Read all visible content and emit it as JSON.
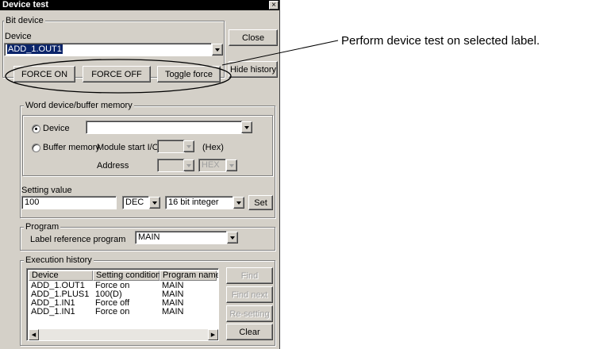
{
  "window": {
    "title": "Device test",
    "close_glyph": "×"
  },
  "bit_device": {
    "legend": "Bit device",
    "device_label": "Device",
    "device_value": "ADD_1.OUT1",
    "force_on": "FORCE ON",
    "force_off": "FORCE OFF",
    "toggle_force": "Toggle force"
  },
  "side_buttons": {
    "close": "Close",
    "hide_history": "Hide history"
  },
  "word_device": {
    "legend": "Word device/buffer memory",
    "device_radio": "Device",
    "buffer_memory_radio": "Buffer memory",
    "module_start_label": "Module start I/O",
    "hex_suffix": "(Hex)",
    "address_label": "Address",
    "address_format": "HEX",
    "selected": "Device"
  },
  "setting": {
    "label": "Setting value",
    "value": "100",
    "radix": "DEC",
    "data_type": "16 bit integer",
    "set": "Set"
  },
  "program": {
    "legend": "Program",
    "label": "Label reference program",
    "value": "MAIN"
  },
  "history": {
    "legend": "Execution history",
    "columns": [
      "Device",
      "Setting condition",
      "Program name"
    ],
    "rows": [
      [
        "ADD_1.OUT1",
        "Force on",
        "MAIN"
      ],
      [
        "ADD_1.PLUS1",
        "100(D)",
        "MAIN"
      ],
      [
        "ADD_1.IN1",
        "Force off",
        "MAIN"
      ],
      [
        "ADD_1.IN1",
        "Force on",
        "MAIN"
      ]
    ],
    "find": "Find",
    "find_next": "Find next",
    "re_setting": "Re-setting",
    "clear": "Clear"
  },
  "annotation": "Perform device test on selected label."
}
